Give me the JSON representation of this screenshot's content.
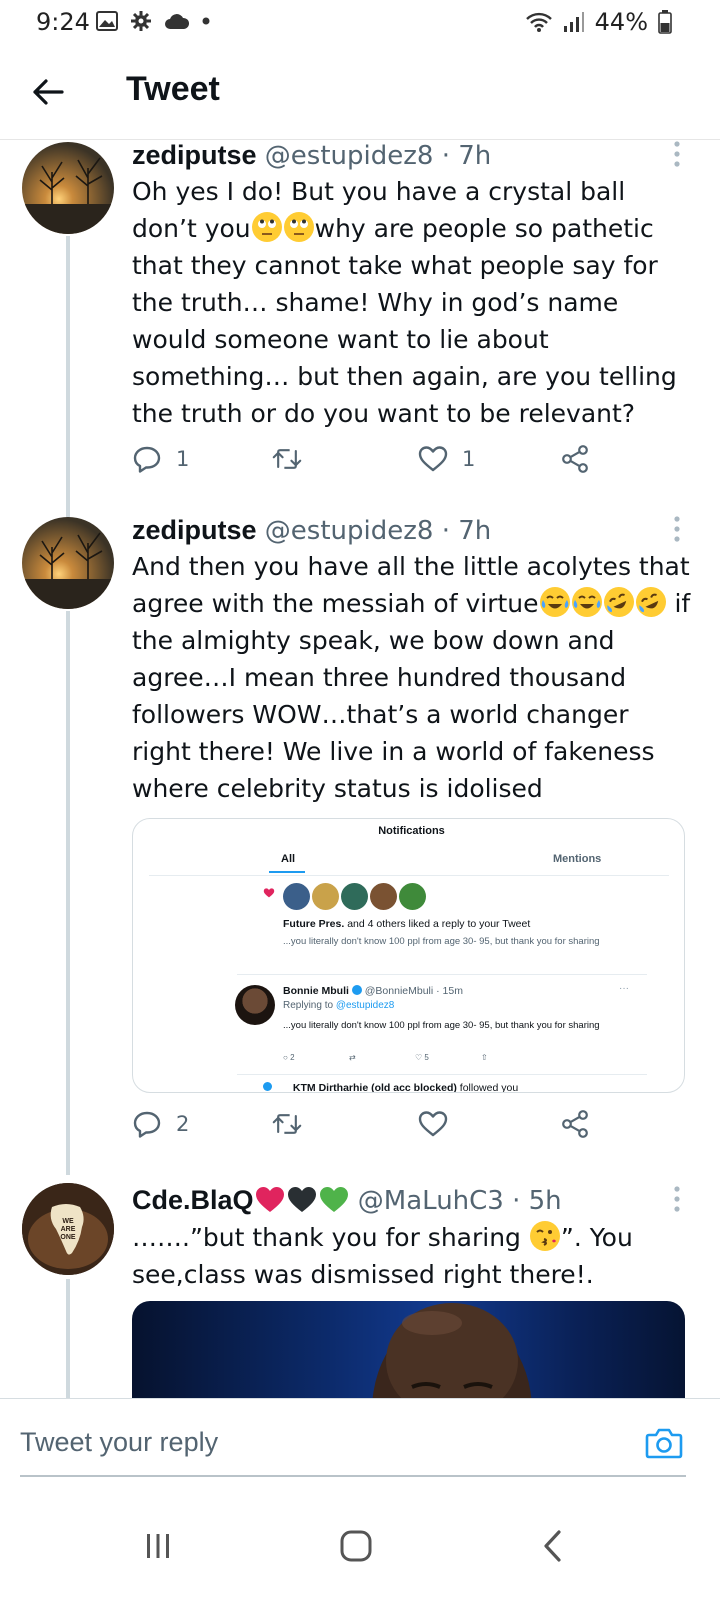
{
  "status_bar": {
    "time": "9:24",
    "battery": "44%"
  },
  "app_bar": {
    "title": "Tweet"
  },
  "tweets": [
    {
      "name": "zediputse",
      "handle": "@estupidez8",
      "dot": "·",
      "time": "7h",
      "text_parts": [
        "Oh yes I do! But you have a crystal ball don’t you",
        "why are people so pathetic that they cannot take what people say for the truth… shame! Why in god’s name would someone want to lie about something… but then again, are you telling the truth or do you want to be relevant?"
      ],
      "reply_count": "1",
      "like_count": "1"
    },
    {
      "name": "zediputse",
      "handle": "@estupidez8",
      "dot": "·",
      "time": "7h",
      "text_parts": [
        "And then you have all the little acolytes that agree with the messiah of virtue",
        "if the almighty speak, we bow down and agree…I mean three hundred thousand followers WOW…that’s a world changer right there! We live in a world of fakeness where celebrity status is idolised"
      ],
      "reply_count": "2",
      "like_count": "",
      "embed": {
        "header": "Notifications",
        "tab_all": "All",
        "tab_mentions": "Mentions",
        "like_name": "Future Pres.",
        "like_rest": "and 4 others liked a reply to your Tweet",
        "like_quote": "...you literally don't know 100 ppl from age 30- 95, but thank you for sharing",
        "reply_name": "Bonnie Mbuli",
        "reply_handle": "@BonnieMbuli · 15m",
        "reply_to_label": "Replying to",
        "reply_to_handle": "@estupidez8",
        "reply_text": "...you literally don't know 100 ppl from age 30- 95, but thank you for sharing",
        "reply_replies": "2",
        "reply_likes": "5",
        "follow_text": "KTM Dirtharhie (old acc blocked)",
        "follow_rest": "followed you"
      }
    },
    {
      "name": "Cde.BlaQ",
      "handle": "@MaLuhC3",
      "dot": "·",
      "time": "5h",
      "text_parts": [
        "…….”but thank you for sharing",
        "”. You see,class was dismissed right there!."
      ],
      "avatar_text": "WE ARE ONE"
    }
  ],
  "reply_bar": {
    "placeholder": "Tweet your reply"
  },
  "colors": {
    "accent": "#1d9bf0",
    "secondary_text": "#536471",
    "heart_red": "#e0245e",
    "heart_green": "#4fb34a"
  },
  "icons": [
    "back-arrow-icon",
    "reply-icon",
    "retweet-icon",
    "like-icon",
    "share-icon",
    "kebab-icon",
    "camera-icon",
    "verified-icon"
  ]
}
